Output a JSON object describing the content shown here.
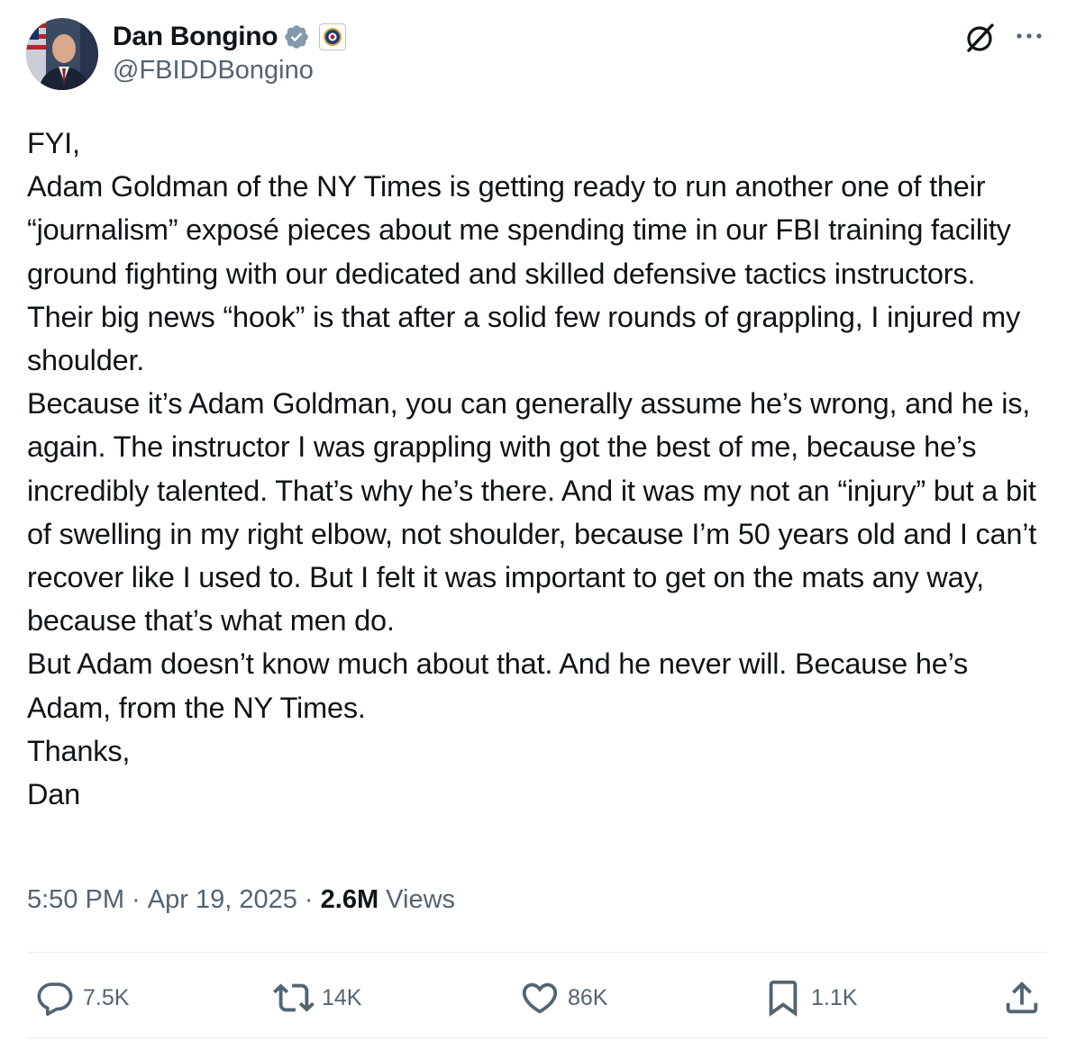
{
  "author": {
    "display_name": "Dan Bongino",
    "handle": "@FBIDDBongino",
    "verified_badge_color": "#829aab",
    "affiliate_badge": "fbi-seal-icon"
  },
  "header_icons": {
    "grok": "grok-icon",
    "more": "more-icon"
  },
  "tweet": {
    "text": "FYI,\nAdam Goldman of the NY Times is getting ready to run another one of their “journalism” exposé pieces about me spending time in our FBI training facility ground fighting with our dedicated and skilled defensive tactics instructors.\nTheir big news “hook” is that after a solid few rounds of grappling, I injured my shoulder.\nBecause it’s Adam Goldman, you can generally assume he’s wrong, and he is, again. The instructor I was grappling with got the best of me, because he’s incredibly talented. That’s why he’s there. And it was my not an “injury” but a bit of swelling in my right elbow, not shoulder, because I’m 50 years old and I can’t recover like I used to. But I felt it was important to get on the mats any way, because that’s what men do.\nBut Adam doesn’t know much about that. And he never will. Because he’s Adam, from the NY Times.\nThanks,\nDan"
  },
  "meta": {
    "time": "5:50 PM",
    "separator": " · ",
    "date": "Apr 19, 2025",
    "views_count": "2.6M",
    "views_label": " Views"
  },
  "actions": {
    "replies": "7.5K",
    "reposts": "14K",
    "likes": "86K",
    "bookmarks": "1.1K"
  },
  "colors": {
    "text_primary": "#0f1419",
    "text_secondary": "#536471",
    "divider": "#e6ecf0",
    "background": "#ffffff"
  }
}
